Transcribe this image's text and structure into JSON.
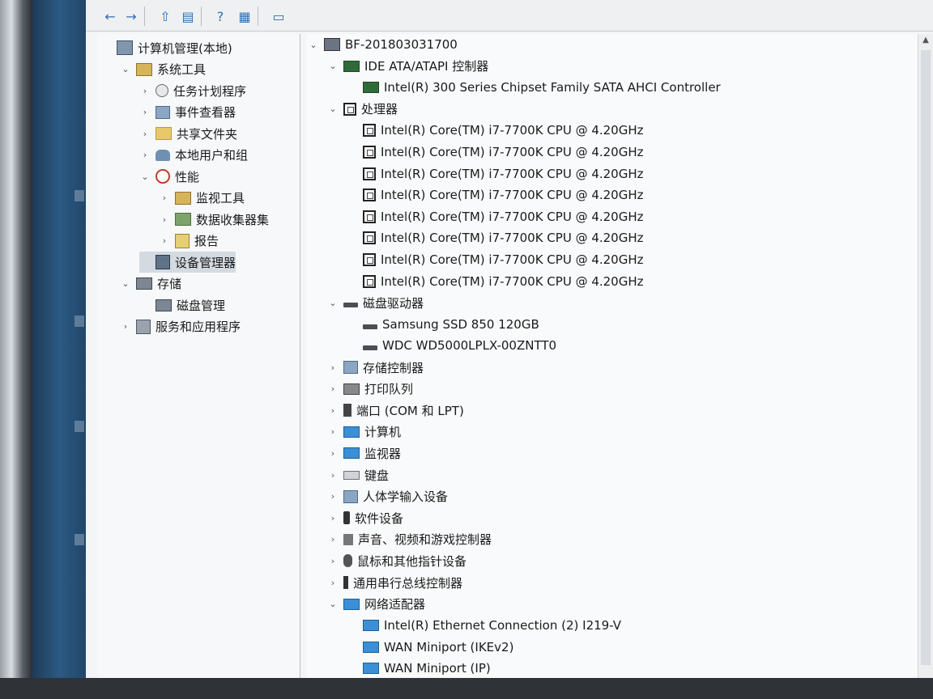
{
  "left_tree": [
    {
      "label": "计算机管理(本地)",
      "arrow": "",
      "icon": "computer-management-icon",
      "level": 0
    },
    {
      "label": "系统工具",
      "arrow": "⌄",
      "icon": "system-tools-icon",
      "level": 1
    },
    {
      "label": "任务计划程序",
      "arrow": "›",
      "icon": "clock-icon",
      "level": 2
    },
    {
      "label": "事件查看器",
      "arrow": "›",
      "icon": "event-viewer-icon",
      "level": 2
    },
    {
      "label": "共享文件夹",
      "arrow": "›",
      "icon": "shared-folder-icon",
      "level": 2
    },
    {
      "label": "本地用户和组",
      "arrow": "›",
      "icon": "users-icon",
      "level": 2
    },
    {
      "label": "性能",
      "arrow": "⌄",
      "icon": "performance-icon",
      "level": 2
    },
    {
      "label": "监视工具",
      "arrow": "›",
      "icon": "monitor-tools-icon",
      "level": 3
    },
    {
      "label": "数据收集器集",
      "arrow": "›",
      "icon": "data-collector-icon",
      "level": 3
    },
    {
      "label": "报告",
      "arrow": "›",
      "icon": "report-icon",
      "level": 3
    },
    {
      "label": "设备管理器",
      "arrow": "",
      "icon": "device-manager-icon",
      "level": 2,
      "selected": true
    },
    {
      "label": "存储",
      "arrow": "⌄",
      "icon": "storage-icon",
      "level": 1
    },
    {
      "label": "磁盘管理",
      "arrow": "",
      "icon": "disk-management-icon",
      "level": 2
    },
    {
      "label": "服务和应用程序",
      "arrow": "›",
      "icon": "services-icon",
      "level": 1
    }
  ],
  "device_tree": [
    {
      "label": "BF-201803031700",
      "arrow": "⌄",
      "icon": "host-icon",
      "level": 0
    },
    {
      "label": "IDE ATA/ATAPI 控制器",
      "arrow": "⌄",
      "icon": "ide-controller-icon",
      "level": 1
    },
    {
      "label": "Intel(R) 300 Series Chipset Family SATA AHCI Controller",
      "arrow": "",
      "icon": "ide-controller-icon",
      "level": 2
    },
    {
      "label": "处理器",
      "arrow": "⌄",
      "icon": "processor-icon",
      "level": 1
    },
    {
      "label": "Intel(R) Core(TM) i7-7700K CPU @ 4.20GHz",
      "arrow": "",
      "icon": "processor-icon",
      "level": 2
    },
    {
      "label": "Intel(R) Core(TM) i7-7700K CPU @ 4.20GHz",
      "arrow": "",
      "icon": "processor-icon",
      "level": 2
    },
    {
      "label": "Intel(R) Core(TM) i7-7700K CPU @ 4.20GHz",
      "arrow": "",
      "icon": "processor-icon",
      "level": 2
    },
    {
      "label": "Intel(R) Core(TM) i7-7700K CPU @ 4.20GHz",
      "arrow": "",
      "icon": "processor-icon",
      "level": 2
    },
    {
      "label": "Intel(R) Core(TM) i7-7700K CPU @ 4.20GHz",
      "arrow": "",
      "icon": "processor-icon",
      "level": 2
    },
    {
      "label": "Intel(R) Core(TM) i7-7700K CPU @ 4.20GHz",
      "arrow": "",
      "icon": "processor-icon",
      "level": 2
    },
    {
      "label": "Intel(R) Core(TM) i7-7700K CPU @ 4.20GHz",
      "arrow": "",
      "icon": "processor-icon",
      "level": 2
    },
    {
      "label": "Intel(R) Core(TM) i7-7700K CPU @ 4.20GHz",
      "arrow": "",
      "icon": "processor-icon",
      "level": 2
    },
    {
      "label": "磁盘驱动器",
      "arrow": "⌄",
      "icon": "disk-drive-icon",
      "level": 1
    },
    {
      "label": "Samsung SSD 850 120GB",
      "arrow": "",
      "icon": "disk-drive-icon",
      "level": 2
    },
    {
      "label": "WDC WD5000LPLX-00ZNTT0",
      "arrow": "",
      "icon": "disk-drive-icon",
      "level": 2
    },
    {
      "label": "存储控制器",
      "arrow": "›",
      "icon": "storage-controller-icon",
      "level": 1
    },
    {
      "label": "打印队列",
      "arrow": "›",
      "icon": "printer-icon",
      "level": 1
    },
    {
      "label": "端口 (COM 和 LPT)",
      "arrow": "›",
      "icon": "port-icon",
      "level": 1
    },
    {
      "label": "计算机",
      "arrow": "›",
      "icon": "computer-icon",
      "level": 1
    },
    {
      "label": "监视器",
      "arrow": "›",
      "icon": "monitor-icon",
      "level": 1
    },
    {
      "label": "键盘",
      "arrow": "›",
      "icon": "keyboard-icon",
      "level": 1
    },
    {
      "label": "人体学输入设备",
      "arrow": "›",
      "icon": "hid-icon",
      "level": 1
    },
    {
      "label": "软件设备",
      "arrow": "›",
      "icon": "software-device-icon",
      "level": 1
    },
    {
      "label": "声音、视频和游戏控制器",
      "arrow": "›",
      "icon": "sound-icon",
      "level": 1
    },
    {
      "label": "鼠标和其他指针设备",
      "arrow": "›",
      "icon": "mouse-icon",
      "level": 1
    },
    {
      "label": "通用串行总线控制器",
      "arrow": "›",
      "icon": "usb-icon",
      "level": 1
    },
    {
      "label": "网络适配器",
      "arrow": "⌄",
      "icon": "network-adapter-icon",
      "level": 1
    },
    {
      "label": "Intel(R) Ethernet Connection (2) I219-V",
      "arrow": "",
      "icon": "network-adapter-icon",
      "level": 2
    },
    {
      "label": "WAN Miniport (IKEv2)",
      "arrow": "",
      "icon": "network-adapter-icon",
      "level": 2
    },
    {
      "label": "WAN Miniport (IP)",
      "arrow": "",
      "icon": "network-adapter-icon",
      "level": 2
    }
  ],
  "toolbar": [
    {
      "name": "back-button",
      "icon": "←"
    },
    {
      "name": "forward-button",
      "icon": "→"
    },
    {
      "name": "up-folder-button",
      "icon": "⇧"
    },
    {
      "name": "show-hide-tree-button",
      "icon": "▤"
    },
    {
      "name": "help-button",
      "icon": "?"
    },
    {
      "name": "properties-button",
      "icon": "▦"
    },
    {
      "name": "monitor-button",
      "icon": "▭"
    }
  ],
  "colors": {
    "selection": "#d4dae2",
    "accent": "#2f6fb4"
  }
}
